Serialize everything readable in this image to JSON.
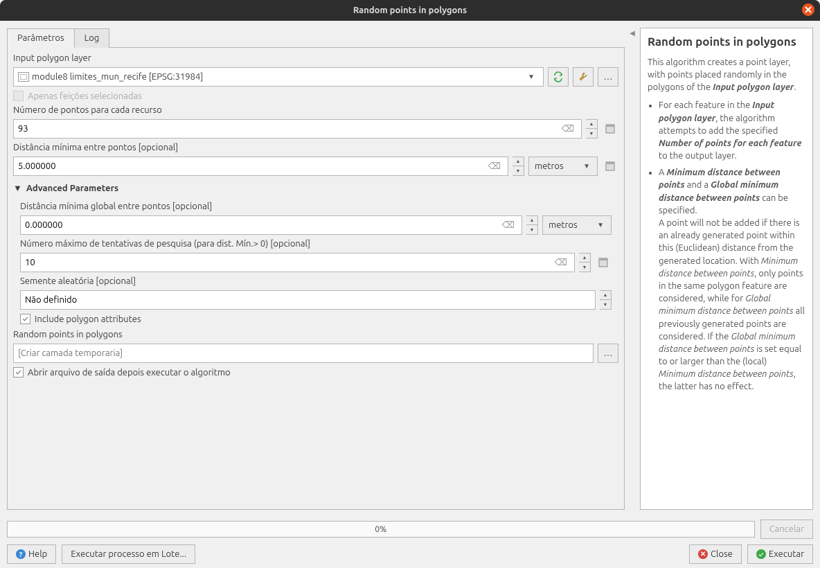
{
  "titlebar": {
    "title": "Random points in polygons"
  },
  "tabs": {
    "params": "Parâmetros",
    "log": "Log"
  },
  "params": {
    "input_layer_label": "Input polygon layer",
    "input_layer_value": "module8 limites_mun_recife [EPSG:31984]",
    "only_selected": "Apenas feições selecionadas",
    "num_points_label": "Número de pontos para cada recurso",
    "num_points_value": "93",
    "min_dist_label": "Distância mínima entre pontos [opcional]",
    "min_dist_value": "5.000000",
    "unit_m": "metros",
    "adv_title": "Advanced Parameters",
    "global_min_label": "Distância mínima global entre pontos [opcional]",
    "global_min_value": "0.000000",
    "max_attempts_label": "Número máximo de tentativas de pesquisa (para dist. Mín.> 0)  [opcional]",
    "max_attempts_value": "10",
    "seed_label": "Semente aleatória [opcional]",
    "seed_value": "Não definido",
    "include_poly_attrs": "Include polygon attributes",
    "output_label": "Random points in polygons",
    "output_placeholder": "[Criar camada temporaria]",
    "open_after": "Abrir arquivo de saída depois executar o algoritmo"
  },
  "help": {
    "title": "Random points in polygons",
    "intro_a": "This algorithm creates a point layer, with points placed randomly in the polygons of the ",
    "intro_b": "Input polygon layer",
    "li1_a": "For each feature in the ",
    "li1_b": "Input polygon layer",
    "li1_c": ", the algorithm attempts to add the specified ",
    "li1_d": "Number of points for each feature",
    "li1_e": " to the output layer.",
    "li2_a": "A ",
    "li2_b": "Minimum distance between points",
    "li2_c": " and a ",
    "li2_d": "Global minimum distance between points",
    "li2_e": " can be specified.",
    "li2_f": "A point will not be added if there is an already generated point within this (Euclidean) distance from the generated location. With ",
    "li2_g": "Minimum distance between points",
    "li2_h": ", only points in the same polygon feature are considered, while for ",
    "li2_i": "Global minimum distance between points",
    "li2_j": " all previously generated points are considered. If the ",
    "li2_k": "Global minimum distance between points",
    "li2_l": " is set equal to or larger than the (local) ",
    "li2_m": "Minimum distance between points",
    "li2_n": ", the latter has no effect."
  },
  "bottom": {
    "progress": "0%",
    "cancel": "Cancelar",
    "help": "Help",
    "batch": "Executar processo em Lote...",
    "close": "Close",
    "run": "Executar"
  }
}
